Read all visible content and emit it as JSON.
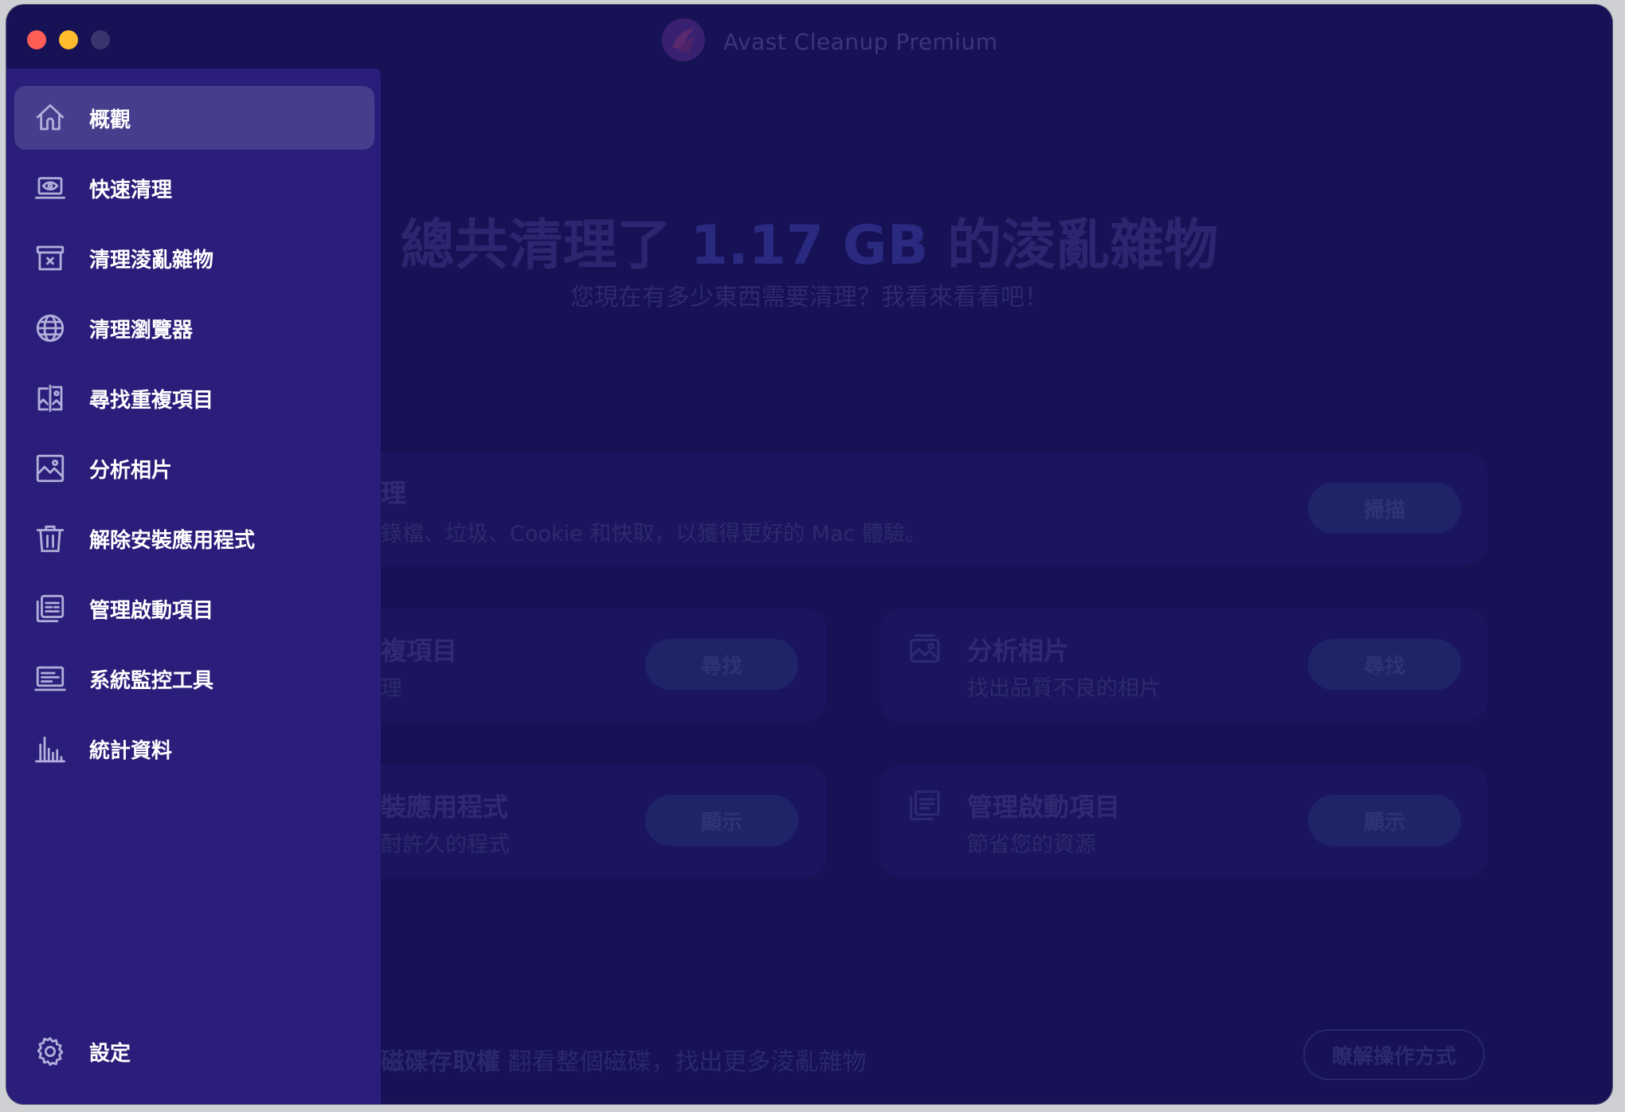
{
  "window": {
    "title": "Avast Cleanup Premium"
  },
  "sidebar": {
    "items": [
      {
        "label": "概觀",
        "icon": "home-icon",
        "active": true
      },
      {
        "label": "快速清理",
        "icon": "quick-clean-icon"
      },
      {
        "label": "清理淩亂雜物",
        "icon": "clutter-box-icon"
      },
      {
        "label": "清理瀏覽器",
        "icon": "globe-icon"
      },
      {
        "label": "尋找重複項目",
        "icon": "duplicates-icon"
      },
      {
        "label": "分析相片",
        "icon": "photo-icon"
      },
      {
        "label": "解除安裝應用程式",
        "icon": "trash-icon"
      },
      {
        "label": "管理啟動項目",
        "icon": "startup-items-icon"
      },
      {
        "label": "系統監控工具",
        "icon": "system-monitor-icon"
      },
      {
        "label": "統計資料",
        "icon": "bar-chart-icon"
      }
    ],
    "settings_label": "設定"
  },
  "main": {
    "headline_pre": "總共清理了",
    "headline_size": "1.17 GB",
    "headline_post": "的淩亂雜物",
    "subline": "您現在有多少東西需要清理？我看來看看吧！",
    "cards": {
      "quick": {
        "title": "理",
        "desc": "錄檔、垃圾、Cookie 和快取，以獲得更好的 Mac 體驗。",
        "button": "掃描"
      },
      "duplicates": {
        "title": "複項目",
        "desc": "理",
        "button": "尋找"
      },
      "photos": {
        "title": "分析相片",
        "desc": "找出品質不良的相片",
        "button": "尋找"
      },
      "uninstall": {
        "title": "裝應用程式",
        "desc": "酎許久的程式",
        "button": "顯示"
      },
      "startup": {
        "title": "管理啟動項目",
        "desc": "節省您的資源",
        "button": "顯示"
      }
    },
    "footer": {
      "bold": "磁碟存取權",
      "text": " 翻看整個磁碟，找出更多淩亂雜物",
      "button": "瞭解操作方式"
    }
  }
}
